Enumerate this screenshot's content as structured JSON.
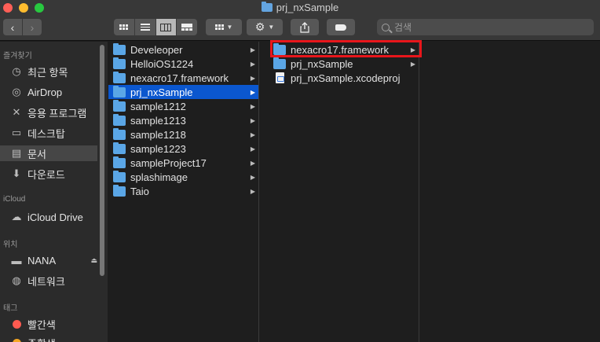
{
  "window": {
    "title": "prj_nxSample"
  },
  "toolbar": {
    "back": "‹",
    "forward": "›",
    "search_placeholder": "검색"
  },
  "sidebar": {
    "sections": {
      "favorites": "즐겨찾기",
      "icloud": "iCloud",
      "locations": "위치",
      "tags": "태그"
    },
    "favorites": [
      {
        "label": "최근 항목",
        "icon": "clock-icon"
      },
      {
        "label": "AirDrop",
        "icon": "airdrop-icon"
      },
      {
        "label": "응용 프로그램",
        "icon": "applications-icon"
      },
      {
        "label": "데스크탑",
        "icon": "desktop-icon"
      },
      {
        "label": "문서",
        "icon": "document-icon"
      },
      {
        "label": "다운로드",
        "icon": "download-icon"
      }
    ],
    "icloud": [
      {
        "label": "iCloud Drive",
        "icon": "cloud-icon"
      }
    ],
    "locations": [
      {
        "label": "NANA",
        "icon": "disk-icon"
      },
      {
        "label": "네트워크",
        "icon": "network-icon"
      }
    ],
    "tags": [
      {
        "label": "빨간색",
        "color": "#ff5a50"
      },
      {
        "label": "주황색",
        "color": "#f5a623"
      }
    ]
  },
  "columns": {
    "col1": [
      "Develeoper",
      "HelloiOS1224",
      "nexacro17.framework",
      "prj_nxSample",
      "sample1212",
      "sample1213",
      "sample1218",
      "sample1223",
      "sampleProject17",
      "splashimage",
      "Taio"
    ],
    "col1_selected": "prj_nxSample",
    "col2": [
      {
        "name": "nexacro17.framework",
        "kind": "folder"
      },
      {
        "name": "prj_nxSample",
        "kind": "folder"
      },
      {
        "name": "prj_nxSample.xcodeproj",
        "kind": "file"
      }
    ]
  },
  "colors": {
    "selection": "#0b57cf",
    "folder": "#5aa6e6",
    "highlight_box": "#e8161b"
  }
}
